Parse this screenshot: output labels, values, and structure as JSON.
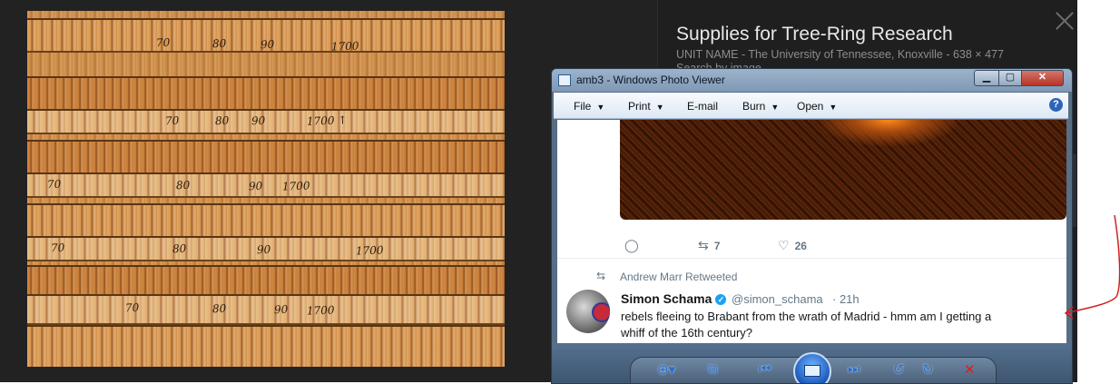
{
  "image_panel": {
    "title": "Supplies for Tree-Ring Research",
    "subtitle": "UNIT NAME - The University of Tennessee, Knoxville - 638 × 477",
    "subtitle2": "Search by image",
    "close_icon": "close-x-icon",
    "next_icon": "chevron-right-icon"
  },
  "tree_image": {
    "core_marks": [
      [
        "70",
        "80",
        "90",
        "1700"
      ],
      [
        "70",
        "80",
        "90",
        "1700 ↑"
      ],
      [
        "70",
        "80",
        "90",
        "1700"
      ],
      [
        "70",
        "80",
        "90",
        "1700"
      ],
      [
        "70",
        "80",
        "90",
        "1700"
      ]
    ]
  },
  "photo_viewer": {
    "title": "amb3 - Windows Photo Viewer",
    "window_buttons": {
      "minimize": "▁",
      "maximize": "▢",
      "close": "✕"
    },
    "menu": [
      {
        "label": "File",
        "has_caret": true
      },
      {
        "label": "Print",
        "has_caret": true
      },
      {
        "label": "E-mail",
        "has_caret": false
      },
      {
        "label": "Burn",
        "has_caret": true
      },
      {
        "label": "Open",
        "has_caret": true
      }
    ],
    "help_label": "?",
    "tweet": {
      "actions": {
        "reply_count": "",
        "retweet_count": "7",
        "like_count": "26"
      },
      "retweeted_by": "Andrew Marr Retweeted",
      "author_name": "Simon Schama",
      "author_handle": "@simon_schama",
      "time": "· 21h",
      "text_line1": "rebels fleeing to Brabant from the wrath of Madrid - hmm am I getting a",
      "text_line2": "whiff of the 16th century?"
    },
    "controls": [
      "zoom-icon",
      "actual-size-icon",
      "previous-icon",
      "slideshow-icon",
      "next-icon",
      "rotate-ccw-icon",
      "rotate-cw-icon",
      "delete-icon"
    ]
  },
  "annotation_color": "#d42020"
}
